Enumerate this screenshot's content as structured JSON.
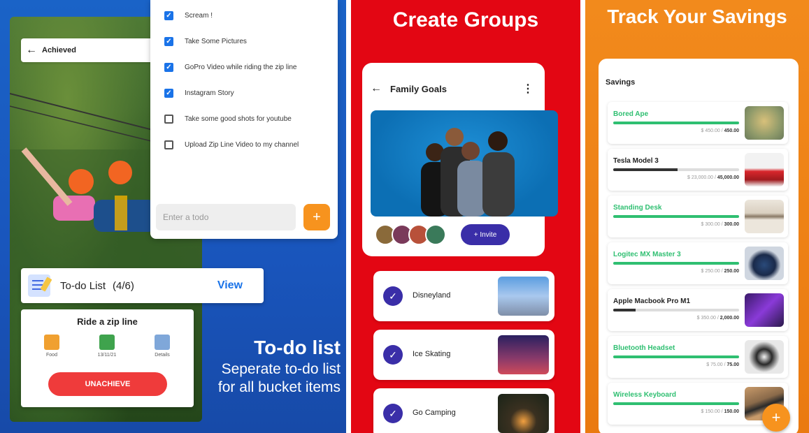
{
  "panel1": {
    "header_back": "←",
    "header_title": "Achieved",
    "todos": [
      {
        "label": "Scream !",
        "checked": true
      },
      {
        "label": "Take Some Pictures",
        "checked": true
      },
      {
        "label": "GoPro Video while riding the zip line",
        "checked": true
      },
      {
        "label": "Instagram Story",
        "checked": true
      },
      {
        "label": "Take some good shots for youtube",
        "checked": false
      },
      {
        "label": "Upload Zip Line Video to my channel",
        "checked": false
      }
    ],
    "todo_input_placeholder": "Enter a todo",
    "add_label": "+",
    "list_title": "To-do List",
    "list_count": "(4/6)",
    "view_label": "View",
    "ride": {
      "title": "Ride a zip line",
      "items": [
        {
          "caption": "Food",
          "icon": "food-icon"
        },
        {
          "caption": "13/11/21",
          "icon": "calendar-icon"
        },
        {
          "caption": "Details",
          "icon": "details-icon"
        }
      ],
      "button": "UNACHIEVE"
    },
    "promo_heading": "To-do list",
    "promo_text": "Seperate to-do list for all bucket items"
  },
  "panel2": {
    "title": "Create Groups",
    "header_back": "←",
    "header_title": "Family Goals",
    "menu_icon": "⋮",
    "invite_label": "+ Invite",
    "goals": [
      {
        "label": "Disneyland",
        "checked": true
      },
      {
        "label": "Ice Skating",
        "checked": true
      },
      {
        "label": "Go Camping",
        "checked": true
      }
    ]
  },
  "panel3": {
    "title": "Track Your Savings",
    "section_title": "Savings",
    "items": [
      {
        "name": "Bored Ape",
        "saved": "$ 450.00",
        "goal": "450.00",
        "progress": 1.0,
        "complete": true
      },
      {
        "name": "Tesla Model 3",
        "saved": "$ 23,000.00",
        "goal": "45,000.00",
        "progress": 0.51,
        "complete": false
      },
      {
        "name": "Standing Desk",
        "saved": "$ 300.00",
        "goal": "300.00",
        "progress": 1.0,
        "complete": true
      },
      {
        "name": "Logitec MX Master 3",
        "saved": "$ 250.00",
        "goal": "250.00",
        "progress": 1.0,
        "complete": true
      },
      {
        "name": "Apple Macbook Pro M1",
        "saved": "$ 350.00",
        "goal": "2,000.00",
        "progress": 0.18,
        "complete": false
      },
      {
        "name": "Bluetooth Headset",
        "saved": "$ 75.00",
        "goal": "75.00",
        "progress": 1.0,
        "complete": true
      },
      {
        "name": "Wireless Keyboard",
        "saved": "$ 150.00",
        "goal": "150.00",
        "progress": 1.0,
        "complete": true
      }
    ],
    "fab_label": "+"
  },
  "colors": {
    "blue_bg": "#1a63c7",
    "red_bg": "#e30613",
    "orange_bg": "#f28a1c",
    "accent_orange": "#f7931e",
    "checkbox_blue": "#1a73e8",
    "purple": "#3a2ea8",
    "green_complete": "#2fbf71"
  }
}
